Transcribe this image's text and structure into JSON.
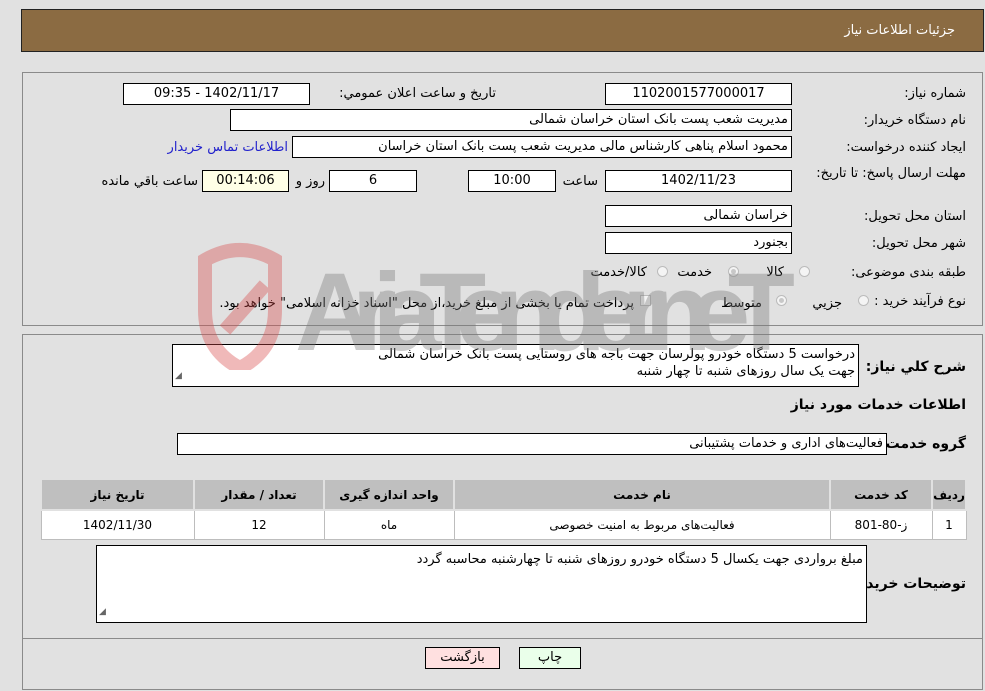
{
  "header": {
    "title": "جزئیات اطلاعات نیاز"
  },
  "form": {
    "need_number_label": "شماره نیاز:",
    "need_number": "1102001577000017",
    "announce_label": "تاریخ و ساعت اعلان عمومي:",
    "announce_value": "1402/11/17 - 09:35",
    "buyer_org_label": "نام دستگاه خریدار:",
    "buyer_org": "مدیریت شعب پست بانک استان خراسان شمالی",
    "creator_label": "ایجاد کننده درخواست:",
    "creator": "محمود  اسلام پناهی  کارشناس مالی مدیریت شعب پست بانک استان خراسان",
    "contact_link": "اطلاعات تماس خریدار",
    "deadline_label": "مهلت ارسال پاسخ: تا تاریخ:",
    "deadline_date": "1402/11/23",
    "time_label": "ساعت",
    "deadline_time": "10:00",
    "days_value": "6",
    "days_label": "روز و",
    "remaining_time": "00:14:06",
    "remaining_label": "ساعت باقي مانده",
    "province_label": "استان محل تحویل:",
    "province": "خراسان شمالی",
    "city_label": "شهر محل تحویل:",
    "city": "بجنورد",
    "category_label": "طبقه بندی موضوعی:",
    "category_options": [
      {
        "label": "کالا",
        "selected": false
      },
      {
        "label": "خدمت",
        "selected": true
      },
      {
        "label": "کالا/خدمت",
        "selected": false
      }
    ],
    "process_label": "نوع فرآیند خرید :",
    "process_options": [
      {
        "label": "جزيي",
        "selected": false
      },
      {
        "label": "متوسط",
        "selected": true
      }
    ],
    "treasury_note": "پرداخت تمام یا بخشی از مبلغ خرید،از محل \"اسناد خزانه اسلامی\" خواهد بود.",
    "treasury_checked": false
  },
  "details": {
    "description_label": "شرح كلي نياز:",
    "description_line1": "درخواست 5 دستگاه خودرو پولرسان جهت باجه های روستایی پست بانک خراسان شمالی",
    "description_line2": "جهت یک سال روزهای شنبه تا چهار شنبه",
    "services_heading": "اطلاعات خدمات مورد نیاز",
    "service_group_label": "گروه خدمت:",
    "service_group": "فعالیت‌های اداری و خدمات پشتیبانی",
    "table": {
      "headers": [
        "ردیف",
        "کد خدمت",
        "نام خدمت",
        "واحد اندازه گیری",
        "تعداد / مقدار",
        "تاریخ نیاز"
      ],
      "rows": [
        [
          "1",
          "ز-80-801",
          "فعالیت‌های مربوط به امنیت خصوصی",
          "ماه",
          "12",
          "1402/11/30"
        ]
      ]
    },
    "buyer_notes_label": "توضیحات خریدار:",
    "buyer_notes": "مبلغ برواردی جهت یکسال  5 دستگاه خودرو روزهای شنبه تا چهارشنبه  محاسبه گردد"
  },
  "buttons": {
    "print": "چاپ",
    "back": "بازگشت"
  },
  "watermark": {
    "text": "AriaTender.neT",
    "color_text": "#7a7a7a",
    "color_logo": "#d84a4a"
  }
}
